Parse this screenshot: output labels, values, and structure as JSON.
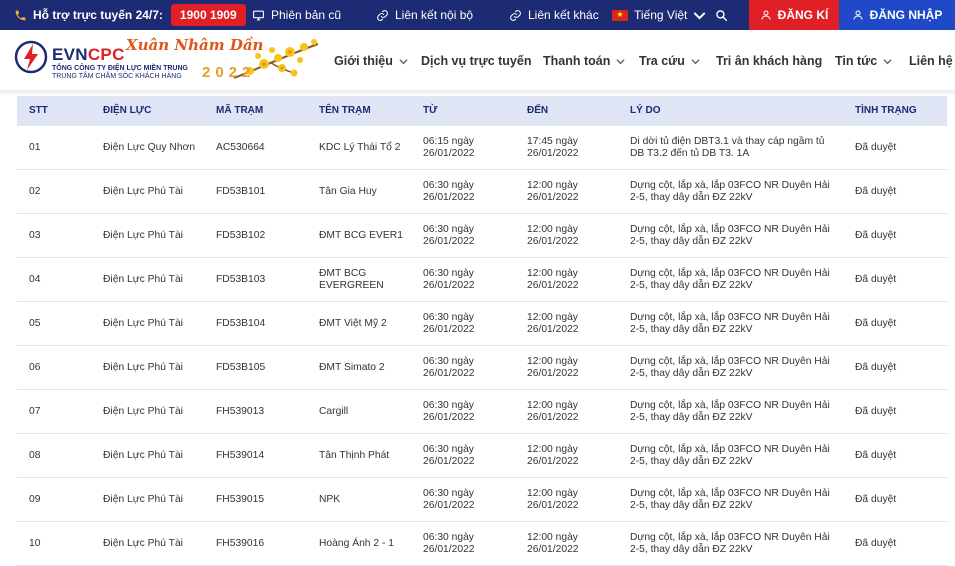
{
  "colors": {
    "topbar": "#1c2b73",
    "accent_red": "#e11f26",
    "login_blue": "#1f49c9",
    "table_header_bg": "#dfe5f5"
  },
  "topbar": {
    "hotline_label": "Hỗ trợ trực tuyến 24/7:",
    "hotline_number": "1900 1909",
    "links": [
      "Phiên bản cũ",
      "Liên kết nội bộ",
      "Liên kết khác"
    ],
    "language": "Tiếng Việt",
    "register": "ĐĂNG KÍ",
    "login": "ĐĂNG NHẬP"
  },
  "logo": {
    "brand_a": "EVN",
    "brand_b": "CPC",
    "sub1": "TỔNG CÔNG TY ĐIỆN LỰC MIỀN TRUNG",
    "sub2": "TRUNG TÂM CHĂM SÓC KHÁCH HÀNG",
    "tet": "Xuân Nhâm Dần",
    "year": "2022"
  },
  "nav": [
    {
      "label": "Giới thiệu",
      "has_dropdown": true
    },
    {
      "label": "Dịch vụ trực tuyến",
      "has_dropdown": false
    },
    {
      "label": "Thanh toán",
      "has_dropdown": true
    },
    {
      "label": "Tra cứu",
      "has_dropdown": true
    },
    {
      "label": "Tri ân khách hàng",
      "has_dropdown": false
    },
    {
      "label": "Tin tức",
      "has_dropdown": true
    },
    {
      "label": "Liên hệ",
      "has_dropdown": false
    }
  ],
  "table": {
    "headers": [
      "STT",
      "ĐIỆN LỰC",
      "MÃ TRẠM",
      "TÊN TRẠM",
      "TỪ",
      "ĐẾN",
      "LÝ DO",
      "TÌNH TRẠNG"
    ],
    "rows": [
      [
        "01",
        "Điện Lực Quy Nhơn",
        "AC530664",
        "KDC Lý Thái Tổ 2",
        "06:15 ngày 26/01/2022",
        "17:45 ngày 26/01/2022",
        "Di dời tủ điện DBT3.1 và thay cáp ngầm tủ DB T3.2 đến tủ DB T3. 1A",
        "Đã duyệt"
      ],
      [
        "02",
        "Điện Lực Phú Tài",
        "FD53B101",
        "Tân Gia Huy",
        "06:30 ngày 26/01/2022",
        "12:00 ngày 26/01/2022",
        "Dựng cột, lắp xà, lắp 03FCO NR Duyên Hải 2-5, thay dây dẫn ĐZ 22kV",
        "Đã duyệt"
      ],
      [
        "03",
        "Điện Lực Phú Tài",
        "FD53B102",
        "ĐMT BCG EVER1",
        "06:30 ngày 26/01/2022",
        "12:00 ngày 26/01/2022",
        "Dựng cột, lắp xà, lắp 03FCO NR Duyên Hải 2-5, thay dây dẫn ĐZ 22kV",
        "Đã duyệt"
      ],
      [
        "04",
        "Điện Lực Phú Tài",
        "FD53B103",
        "ĐMT BCG EVERGREEN",
        "06:30 ngày 26/01/2022",
        "12:00 ngày 26/01/2022",
        "Dựng cột, lắp xà, lắp 03FCO NR Duyên Hải 2-5, thay dây dẫn ĐZ 22kV",
        "Đã duyệt"
      ],
      [
        "05",
        "Điện Lực Phú Tài",
        "FD53B104",
        "ĐMT Việt Mỹ 2",
        "06:30 ngày 26/01/2022",
        "12:00 ngày 26/01/2022",
        "Dựng cột, lắp xà, lắp 03FCO NR Duyên Hải 2-5, thay dây dẫn ĐZ 22kV",
        "Đã duyệt"
      ],
      [
        "06",
        "Điện Lực Phú Tài",
        "FD53B105",
        "ĐMT Simato 2",
        "06:30 ngày 26/01/2022",
        "12:00 ngày 26/01/2022",
        "Dựng cột, lắp xà, lắp 03FCO NR Duyên Hải 2-5, thay dây dẫn ĐZ 22kV",
        "Đã duyệt"
      ],
      [
        "07",
        "Điện Lực Phú Tài",
        "FH539013",
        "Cargill",
        "06:30 ngày 26/01/2022",
        "12:00 ngày 26/01/2022",
        "Dựng cột, lắp xà, lắp 03FCO NR Duyên Hải 2-5, thay dây dẫn ĐZ 22kV",
        "Đã duyệt"
      ],
      [
        "08",
        "Điện Lực Phú Tài",
        "FH539014",
        "Tân Thịnh Phát",
        "06:30 ngày 26/01/2022",
        "12:00 ngày 26/01/2022",
        "Dựng cột, lắp xà, lắp 03FCO NR Duyên Hải 2-5, thay dây dẫn ĐZ 22kV",
        "Đã duyệt"
      ],
      [
        "09",
        "Điện Lực Phú Tài",
        "FH539015",
        "NPK",
        "06:30 ngày 26/01/2022",
        "12:00 ngày 26/01/2022",
        "Dựng cột, lắp xà, lắp 03FCO NR Duyên Hải 2-5, thay dây dẫn ĐZ 22kV",
        "Đã duyệt"
      ],
      [
        "10",
        "Điện Lực Phú Tài",
        "FH539016",
        "Hoàng Ánh 2 - 1",
        "06:30 ngày 26/01/2022",
        "12:00 ngày 26/01/2022",
        "Dựng cột, lắp xà, lắp 03FCO NR Duyên Hải 2-5, thay dây dẫn ĐZ 22kV",
        "Đã duyệt"
      ]
    ]
  }
}
